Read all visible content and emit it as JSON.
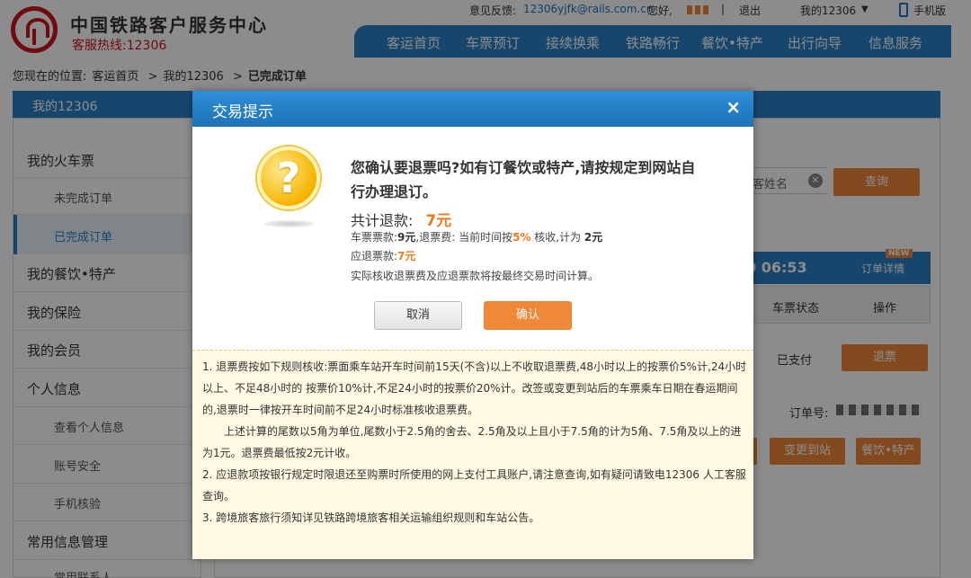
{
  "header": {
    "brand_title": "中国铁路客户服务中心",
    "hotline": "客服热线:12306",
    "feedback_label": "意见反馈:",
    "feedback_email": "12306yjfk@rails.com.cn",
    "greeting": "您好,",
    "logout": "退出",
    "my12306": "我的12306",
    "mobile": "手机版",
    "nav": [
      "客运首页",
      "车票预订",
      "接续换乘",
      "铁路畅行",
      "餐饮•特产",
      "出行向导",
      "信息服务"
    ]
  },
  "breadcrumb": {
    "prefix": "您现在的位置:",
    "items": [
      "客运首页",
      "我的12306",
      "已完成订单"
    ],
    "sep": ">"
  },
  "sidebar": {
    "title": "我的12306",
    "items": [
      {
        "label": "我的火车票",
        "type": "main"
      },
      {
        "label": "未完成订单",
        "type": "sub"
      },
      {
        "label": "已完成订单",
        "type": "active"
      },
      {
        "label": "我的餐饮•特产",
        "type": "main"
      },
      {
        "label": "我的保险",
        "type": "main"
      },
      {
        "label": "我的会员",
        "type": "main"
      },
      {
        "label": "个人信息",
        "type": "main"
      },
      {
        "label": "查看个人信息",
        "type": "sub"
      },
      {
        "label": "账号安全",
        "type": "sub"
      },
      {
        "label": "手机核验",
        "type": "sub"
      },
      {
        "label": "常用信息管理",
        "type": "main"
      },
      {
        "label": "常用联系人",
        "type": "sub"
      }
    ]
  },
  "main": {
    "search_placeholder": "客姓名",
    "search_button": "查询",
    "countdown": "0 06:53",
    "order_detail": "订单详情",
    "new_badge": "NEW",
    "col_status": "车票状态",
    "col_action": "操作",
    "status": "已支付",
    "refund_button": "退票",
    "order_no_label": "订单号:",
    "change_station": "变更到站",
    "food_button": "餐饮•特产"
  },
  "dialog": {
    "title": "交易提示",
    "close": "×",
    "question": "您确认要退票吗?如有订餐饮或特产,请按规定到网站自行办理退订。",
    "total_label": "共计退款:",
    "total_value": "7元",
    "fare_label": "车票票款:",
    "fare_value": "9元",
    "fee_text": ",退票费:  当前时间按",
    "fee_rate": "5%",
    "fee_mid": " 核收,计为 ",
    "fee_value": "2元",
    "refund_label": "应退票款:",
    "refund_value": "7元",
    "note": "实际核收退票费及应退票款将按最终交易时间计算。",
    "cancel": "取消",
    "confirm": "确认",
    "rules": [
      "1. 退票费按如下规则核收:票面乘车站开车时间前15天(不含)以上不收取退票费,48小时以上的按票价5%计,24小时以上、不足48小时的 按票价10%计,不足24小时的按票价20%计。改签或变更到站后的车票乘车日期在春运期间的,退票时一律按开车时间前不足24小时标准核收退票费。",
      "上述计算的尾数以5角为单位,尾数小于2.5角的舍去、2.5角及以上且小于7.5角的计为5角、7.5角及以上的进为1元。退票费最低按2元计收。",
      "2. 应退款项按银行规定时限退还至购票时所使用的网上支付工具账户,请注意查询,如有疑问请致电12306 人工客服查询。",
      "3. 跨境旅客旅行须知详见铁路跨境旅客相关运输组织规则和车站公告。"
    ]
  }
}
